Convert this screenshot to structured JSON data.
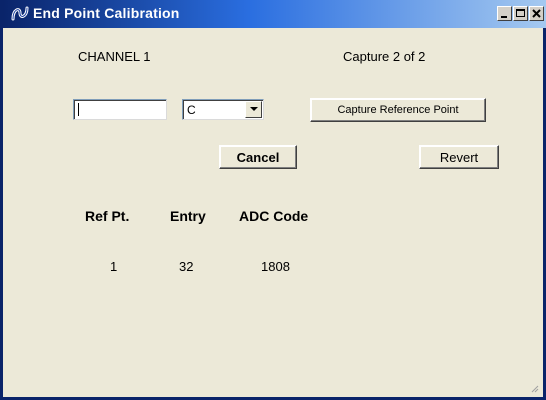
{
  "window": {
    "title": "End Point Calibration",
    "controls": [
      "minimize-icon",
      "maximize-icon",
      "close-icon"
    ]
  },
  "channel_label": "CHANNEL 1",
  "capture_status": "Capture 2 of 2",
  "entry_input": {
    "value": "",
    "placeholder": ""
  },
  "unit_select": {
    "selected": "C"
  },
  "buttons": {
    "capture": "Capture Reference Point",
    "cancel": "Cancel",
    "revert": "Revert"
  },
  "table": {
    "headers": [
      "Ref Pt.",
      "Entry",
      "ADC Code"
    ],
    "rows": [
      [
        "1",
        "32",
        "1808"
      ]
    ]
  }
}
